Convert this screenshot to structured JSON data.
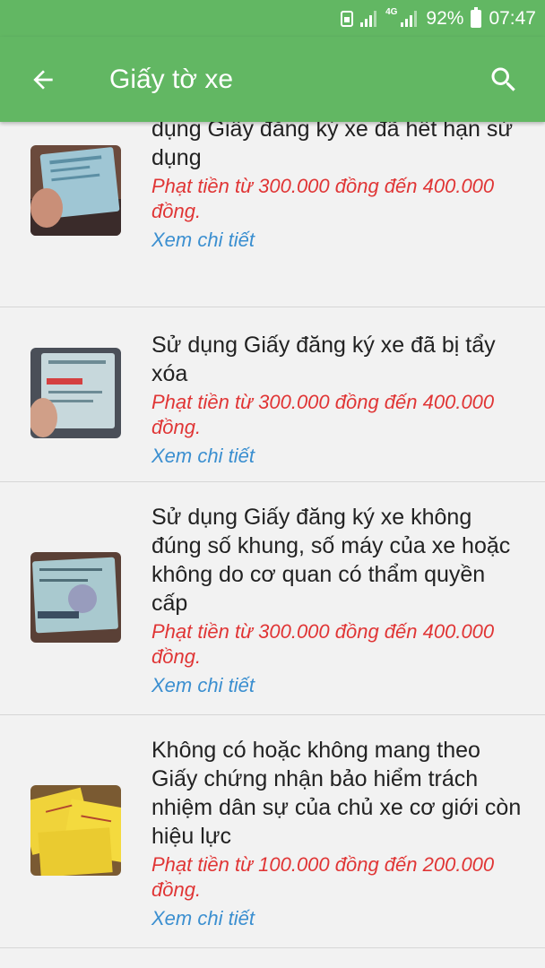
{
  "status_bar": {
    "lte": "4G",
    "battery": "92%",
    "time": "07:47"
  },
  "toolbar": {
    "title": "Giấy tờ xe",
    "back_icon": "arrow-left-icon",
    "search_icon": "search-icon"
  },
  "colors": {
    "primary": "#62b763",
    "penalty": "#e03535",
    "link": "#3b8fd0",
    "background": "#f2f2f2"
  },
  "items": [
    {
      "title": "đăng ký xe theo quy định hoặc sử dụng Giấy đăng ký xe đã hết hạn sử dụng",
      "penalty": "Phạt tiền từ 300.000 đồng đến 400.000 đồng.",
      "detail_link": "Xem chi tiết"
    },
    {
      "title": "Sử dụng Giấy đăng ký xe đã bị tẩy xóa",
      "penalty": "Phạt tiền từ 300.000 đồng đến 400.000 đồng.",
      "detail_link": "Xem chi tiết"
    },
    {
      "title": "Sử dụng Giấy đăng ký xe không đúng số khung, số máy của xe hoặc không do cơ quan có thẩm quyền cấp",
      "penalty": "Phạt tiền từ 300.000 đồng đến 400.000 đồng.",
      "detail_link": "Xem chi tiết"
    },
    {
      "title": "Không có hoặc không mang theo Giấy chứng nhận bảo hiểm trách nhiệm dân sự của chủ xe cơ giới còn hiệu lực",
      "penalty": "Phạt tiền từ 100.000 đồng đến 200.000 đồng.",
      "detail_link": "Xem chi tiết"
    }
  ]
}
